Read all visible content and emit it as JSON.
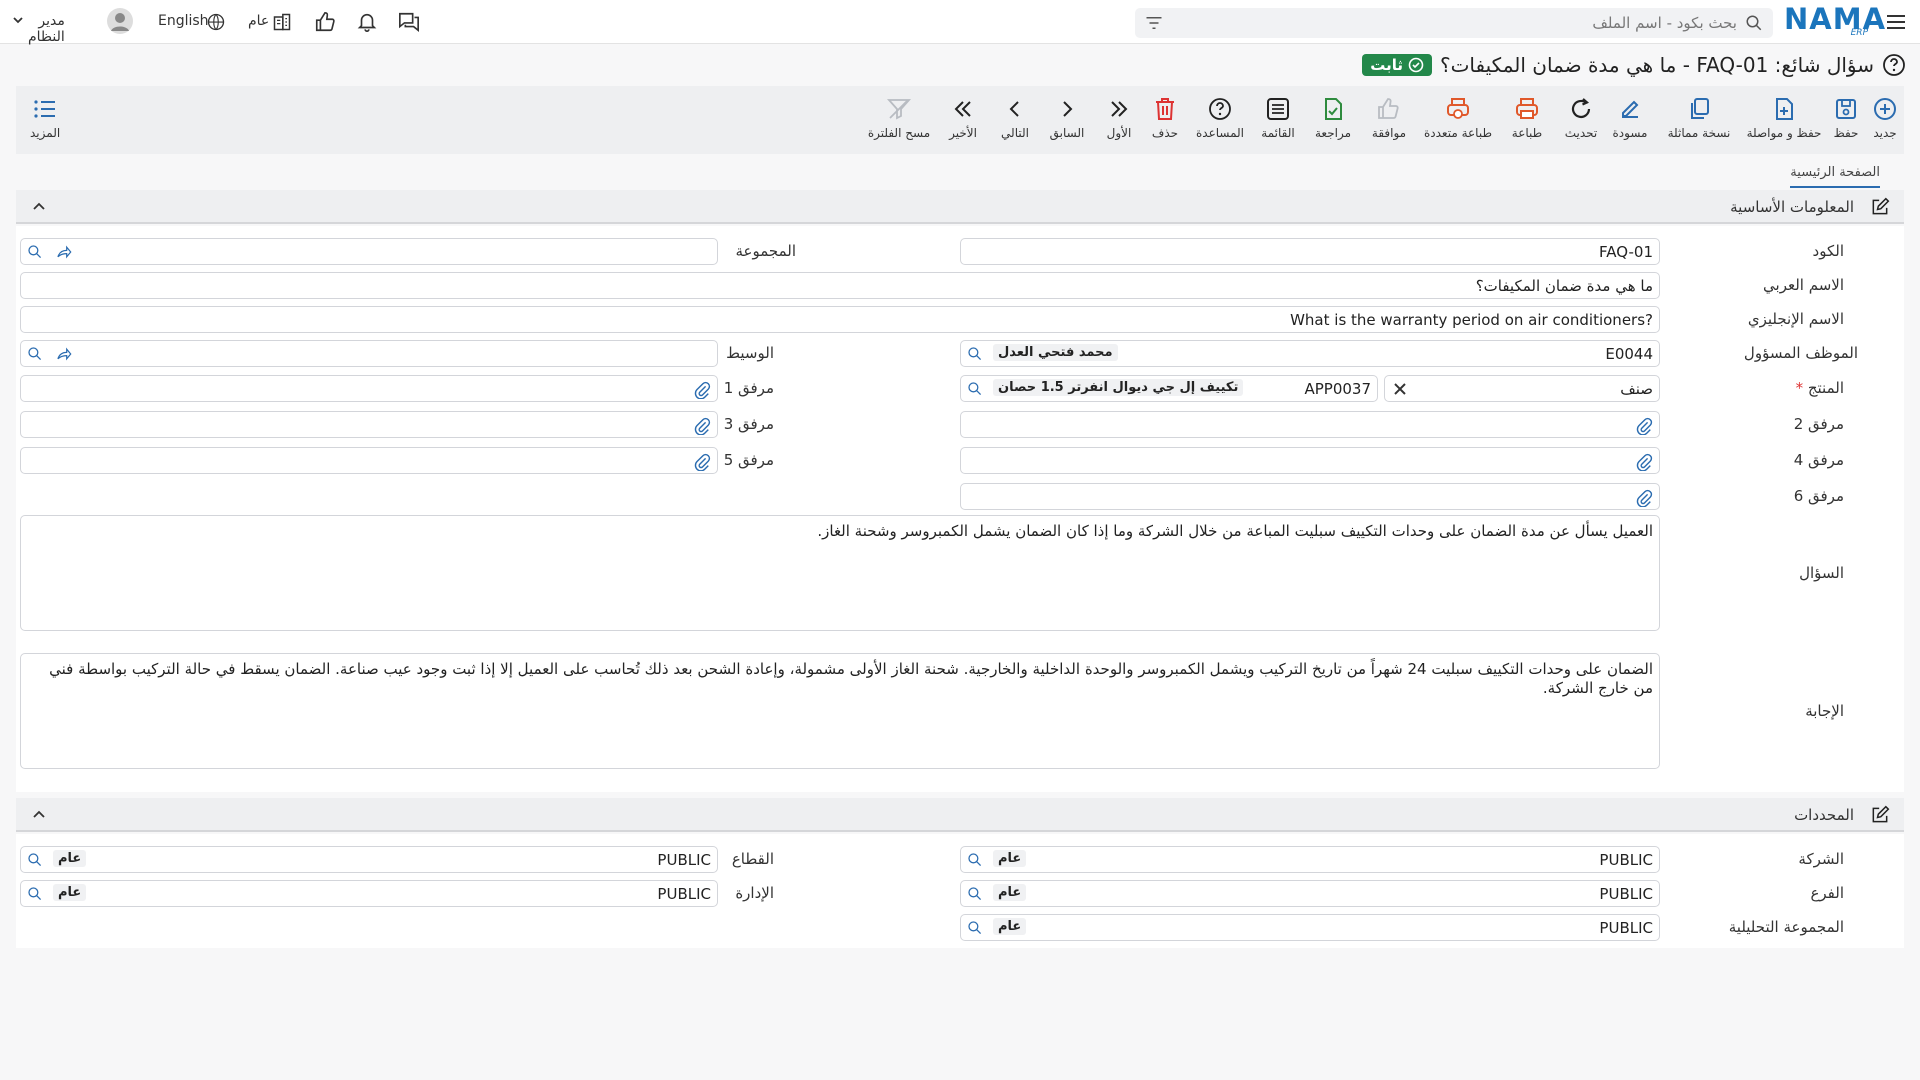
{
  "topbar": {
    "logo": "NAMA",
    "logo_sub": "ERP",
    "search_placeholder": "بحث بكود - اسم الملف",
    "user": "مدير النظام",
    "language": "English",
    "scope": "عام"
  },
  "page": {
    "title": "سؤال شائع: FAQ-01 - ما هي مدة ضمان المكيفات؟",
    "status": "ثابت"
  },
  "toolbar": {
    "more": "المزيد",
    "buttons": [
      "جديد",
      "حفظ",
      "حفظ و مواصلة",
      "نسخة مماثلة",
      "مسودة",
      "تحديث",
      "طباعة",
      "طباعة متعددة",
      "موافقة",
      "مراجعة",
      "القائمة",
      "المساعدة",
      "حذف",
      "الأول",
      "السابق",
      "التالي",
      "الأخير",
      "مسح الفلترة"
    ]
  },
  "tabs": [
    "الصفحة الرئيسية"
  ],
  "basic": {
    "title": "المعلومات الأساسية",
    "code_label": "الكود",
    "code": "FAQ-01",
    "group_label": "المجموعة",
    "arname_label": "الاسم العربي",
    "arname": "ما هي مدة ضمان المكيفات؟",
    "enname_label": "الاسم الإنجليزي",
    "enname": "?What is the warranty period on air conditioners",
    "employee_label": "الموظف المسؤول",
    "employee_code": "E0044",
    "employee_name": "محمد فتحي العدل",
    "broker_label": "الوسيط",
    "product_label": "المنتج",
    "product_type": "صنف",
    "product_code": "APP0037",
    "product_name": "تكييف إل جي ديوال انفرتر 1.5 حصان",
    "att1": "مرفق 1",
    "att2": "مرفق 2",
    "att3": "مرفق 3",
    "att4": "مرفق 4",
    "att5": "مرفق 5",
    "att6": "مرفق 6",
    "question_label": "السؤال",
    "question": "العميل يسأل عن مدة الضمان على وحدات التكييف سبليت المباعة من خلال الشركة وما إذا كان الضمان يشمل الكمبروسر وشحنة الغاز.",
    "answer_label": "الإجابة",
    "answer": "الضمان على وحدات التكييف سبليت 24 شهراً من تاريخ التركيب ويشمل الكمبروسر والوحدة الداخلية والخارجية. شحنة الغاز الأولى مشمولة، وإعادة الشحن بعد ذلك تُحاسب على العميل إلا إذا ثبت وجود عيب صناعة. الضمان يسقط في حالة التركيب بواسطة فني من خارج الشركة."
  },
  "dims": {
    "title": "المحددات",
    "company_label": "الشركة",
    "sector_label": "القطاع",
    "branch_label": "الفرع",
    "dept_label": "الإدارة",
    "analytic_label": "المجموعة التحليلية",
    "code": "PUBLIC",
    "name": "عام"
  }
}
